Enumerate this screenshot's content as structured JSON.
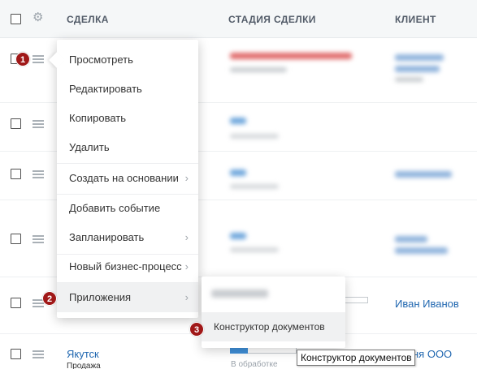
{
  "header": {
    "col_deal": "СДЕЛКА",
    "col_stage": "СТАДИЯ СДЕЛКИ",
    "col_client": "КЛИЕНТ"
  },
  "menu": {
    "items": [
      {
        "label": "Просмотреть"
      },
      {
        "label": "Редактировать"
      },
      {
        "label": "Копировать"
      },
      {
        "label": "Удалить"
      },
      {
        "label": "Создать на основании",
        "arrow": "›"
      },
      {
        "label": "Добавить событие"
      },
      {
        "label": "Запланировать",
        "arrow": "›"
      },
      {
        "label": "Новый бизнес-процесс",
        "arrow": "›"
      },
      {
        "label": "Приложения",
        "arrow": "›"
      }
    ]
  },
  "submenu": {
    "item": "Конструктор документов"
  },
  "badges": [
    "1",
    "2",
    "3"
  ],
  "tooltip": "Конструктор документов",
  "rows": {
    "client_ivan": "Иван Иванов",
    "deal_yakutsk": "Якутск",
    "deal_type": "Продажа",
    "stage_status": "В обработке",
    "client_company": "ня ООО"
  },
  "colors": {
    "accent_blue": "#2067b0",
    "badge_red": "#a01818",
    "stage_blue": "#3f8fd8"
  }
}
